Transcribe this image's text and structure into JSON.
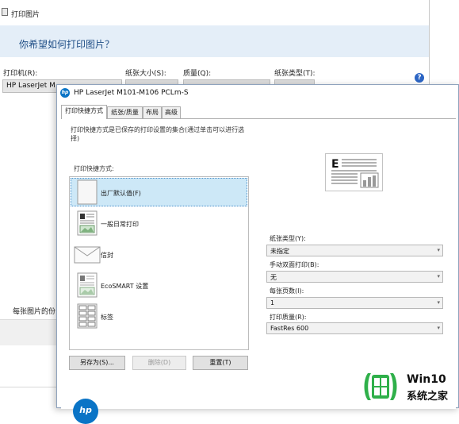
{
  "back_window": {
    "title": "打印图片",
    "heading": "你希望如何打印图片？",
    "printer_label": "打印机(R):",
    "printer_value": "HP LaserJet M",
    "paper_size_label": "纸张大小(S):",
    "quality_label": "质量(Q):",
    "paper_type_label": "纸张类型(T):",
    "per_image_label": "每张图片的份"
  },
  "dialog": {
    "title": "HP LaserJet M101-M106 PCLm-S",
    "tabs": [
      {
        "label": "打印快捷方式",
        "active": true
      },
      {
        "label": "纸张/质量",
        "active": false
      },
      {
        "label": "布局",
        "active": false
      },
      {
        "label": "高级",
        "active": false
      }
    ],
    "description": "打印快捷方式是已保存的打印设置的集合(通过单击可以进行选择)",
    "shortcuts_label": "打印快捷方式:",
    "shortcuts": [
      {
        "label": "出厂默认值(F)",
        "selected": true,
        "icon": "blank-page-icon"
      },
      {
        "label": "一般日常打印",
        "selected": false,
        "icon": "document-page-icon"
      },
      {
        "label": "信封",
        "selected": false,
        "icon": "envelope-icon"
      },
      {
        "label": "EcoSMART 设置",
        "selected": false,
        "icon": "eco-document-icon"
      },
      {
        "label": "标签",
        "selected": false,
        "icon": "labels-sheet-icon"
      }
    ],
    "buttons": {
      "save_as": "另存为(S)...",
      "delete": "删除(D)",
      "reset": "重置(T)"
    },
    "settings": {
      "paper_type": {
        "label": "纸张类型(Y):",
        "value": "未指定"
      },
      "duplex": {
        "label": "手动双面打印(B):",
        "value": "无"
      },
      "pages_per_sheet": {
        "label": "每张页数(I):",
        "value": "1"
      },
      "print_quality": {
        "label": "打印质量(R):",
        "value": "FastRes 600"
      }
    },
    "preview_letter": "E",
    "hp_logo_text": "hp"
  },
  "watermark": {
    "line1": "Win10",
    "line2": "系统之家"
  },
  "colors": {
    "accent_blue": "#0a74c6",
    "selection": "#cde8f7",
    "header_band": "#e4eef8",
    "watermark_green": "#2fb04a"
  }
}
